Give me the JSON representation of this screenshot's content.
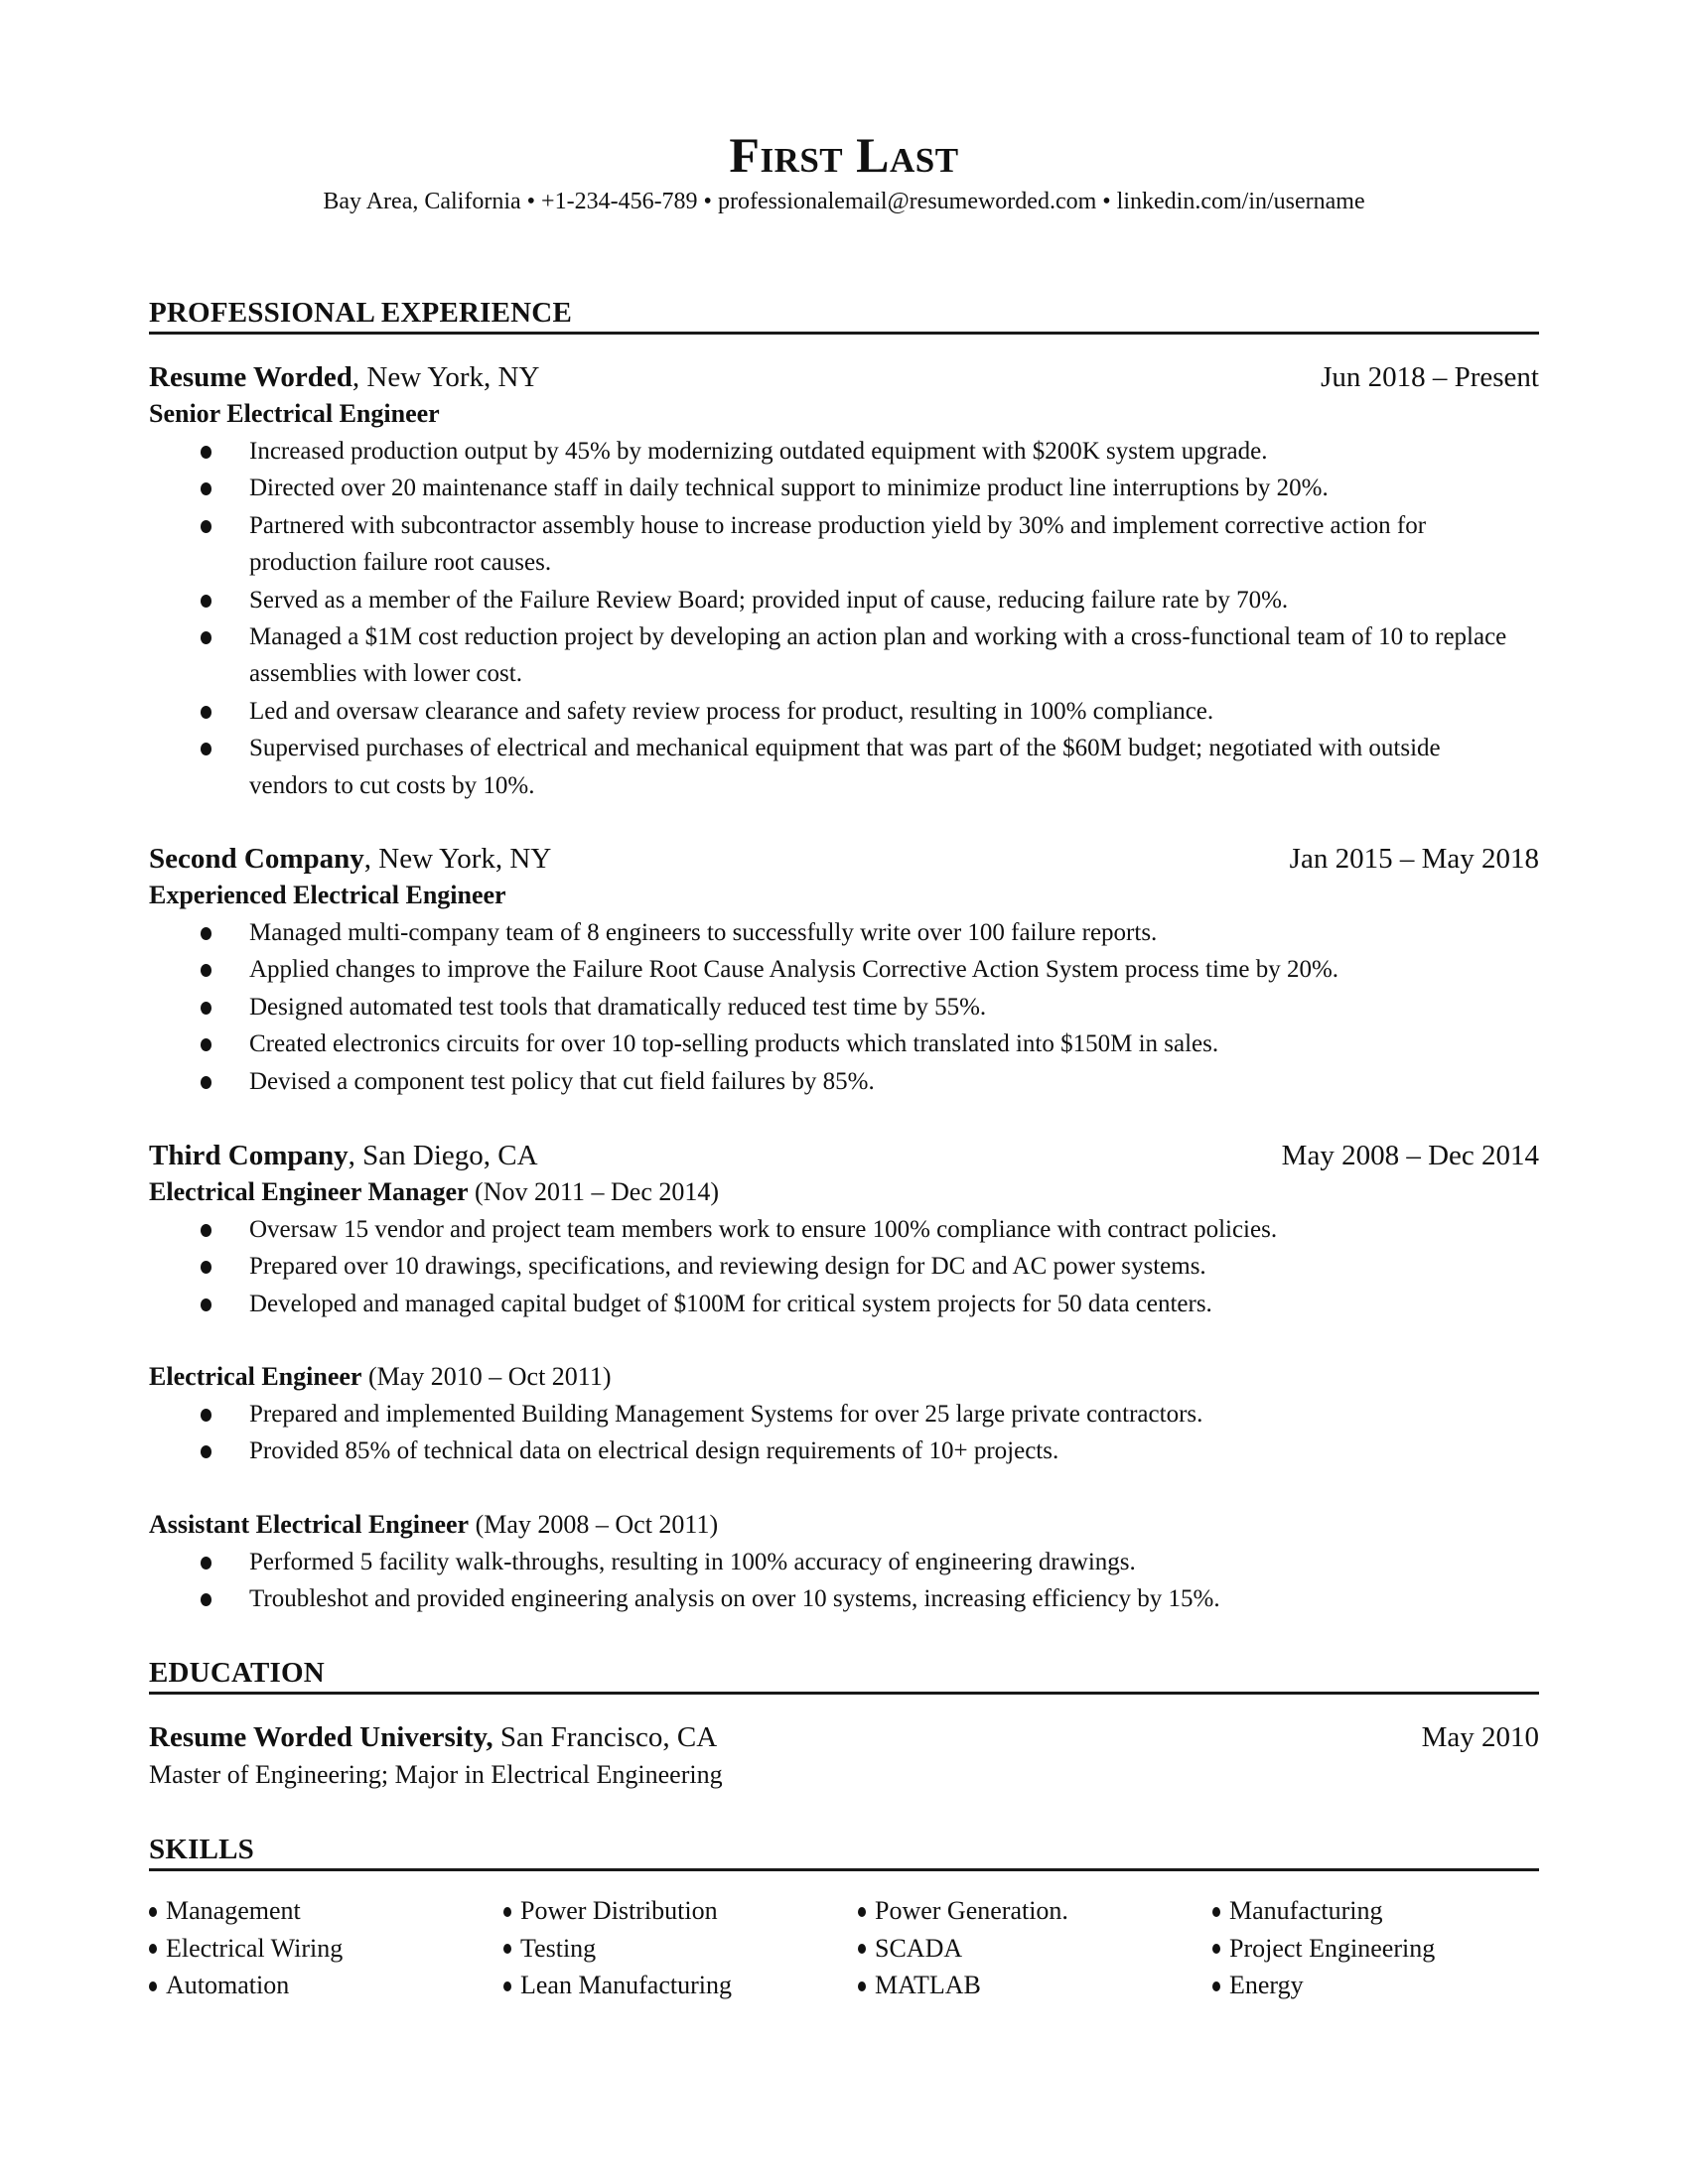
{
  "header": {
    "name": "First Last",
    "contact": "Bay Area, California • +1-234-456-789 • professionalemail@resumeworded.com • linkedin.com/in/username"
  },
  "experience": {
    "title": "PROFESSIONAL EXPERIENCE",
    "jobs": [
      {
        "company": "Resume Worded",
        "location": ", New York, NY",
        "dates": "Jun 2018 – Present",
        "roles": [
          {
            "title": "Senior Electrical Engineer",
            "period": "",
            "bullets": [
              "Increased production output by 45% by modernizing outdated equipment with $200K system upgrade.",
              "Directed over 20 maintenance staff in daily technical support to minimize product line interruptions by 20%.",
              "Partnered with subcontractor assembly house to increase production yield by 30% and implement corrective action for production failure root causes.",
              "Served as a member of the Failure Review Board; provided input of cause, reducing failure rate by 70%.",
              "Managed a $1M cost reduction project by developing an action plan and working with a cross-functional team of 10 to replace assemblies with lower cost.",
              "Led and oversaw clearance and safety review process for product, resulting in 100% compliance.",
              "Supervised purchases of electrical and mechanical equipment that was part of the $60M budget; negotiated with outside vendors to cut costs by 10%."
            ]
          }
        ]
      },
      {
        "company": "Second Company",
        "location": ", New York, NY",
        "dates": "Jan 2015 – May 2018",
        "roles": [
          {
            "title": "Experienced Electrical Engineer",
            "period": "",
            "bullets": [
              "Managed multi-company team of 8 engineers to successfully write over 100 failure reports.",
              "Applied changes to improve the Failure Root Cause Analysis Corrective Action System process time by 20%.",
              "Designed automated test tools that dramatically reduced test time by 55%.",
              "Created electronics circuits for over 10 top-selling products which translated into $150M in sales.",
              "Devised a component test policy that cut field failures by 85%."
            ]
          }
        ]
      },
      {
        "company": "Third Company",
        "location": ", San Diego, CA",
        "dates": "May 2008 – Dec 2014",
        "roles": [
          {
            "title": "Electrical Engineer Manager",
            "period": " (Nov 2011 – Dec 2014)",
            "bullets": [
              "Oversaw 15 vendor and project team members work to ensure 100% compliance with contract policies.",
              "Prepared over 10 drawings, specifications, and reviewing design for DC and AC power systems.",
              "Developed and managed capital budget of $100M for critical system projects for 50 data centers."
            ]
          },
          {
            "title": "Electrical Engineer",
            "period": " (May 2010 – Oct 2011)",
            "bullets": [
              "Prepared and implemented Building Management Systems for over 25 large private contractors.",
              "Provided 85% of technical data on electrical design requirements of 10+ projects."
            ]
          },
          {
            "title": "Assistant Electrical Engineer",
            "period": " (May 2008 – Oct 2011)",
            "bullets": [
              "Performed 5 facility walk-throughs, resulting in 100% accuracy of engineering drawings.",
              "Troubleshot and provided engineering analysis on over 10 systems, increasing efficiency by 15%."
            ]
          }
        ]
      }
    ]
  },
  "education": {
    "title": "EDUCATION",
    "school": "Resume Worded University,",
    "location": " San Francisco, CA",
    "date": "May 2010",
    "degree": "Master of Engineering; Major in Electrical Engineering"
  },
  "skills": {
    "title": "SKILLS",
    "items": [
      "Management",
      "Power Distribution",
      "Power Generation.",
      "Manufacturing",
      "Electrical Wiring",
      "Testing",
      "SCADA",
      "Project Engineering",
      "Automation",
      "Lean Manufacturing",
      "MATLAB",
      "Energy"
    ]
  }
}
